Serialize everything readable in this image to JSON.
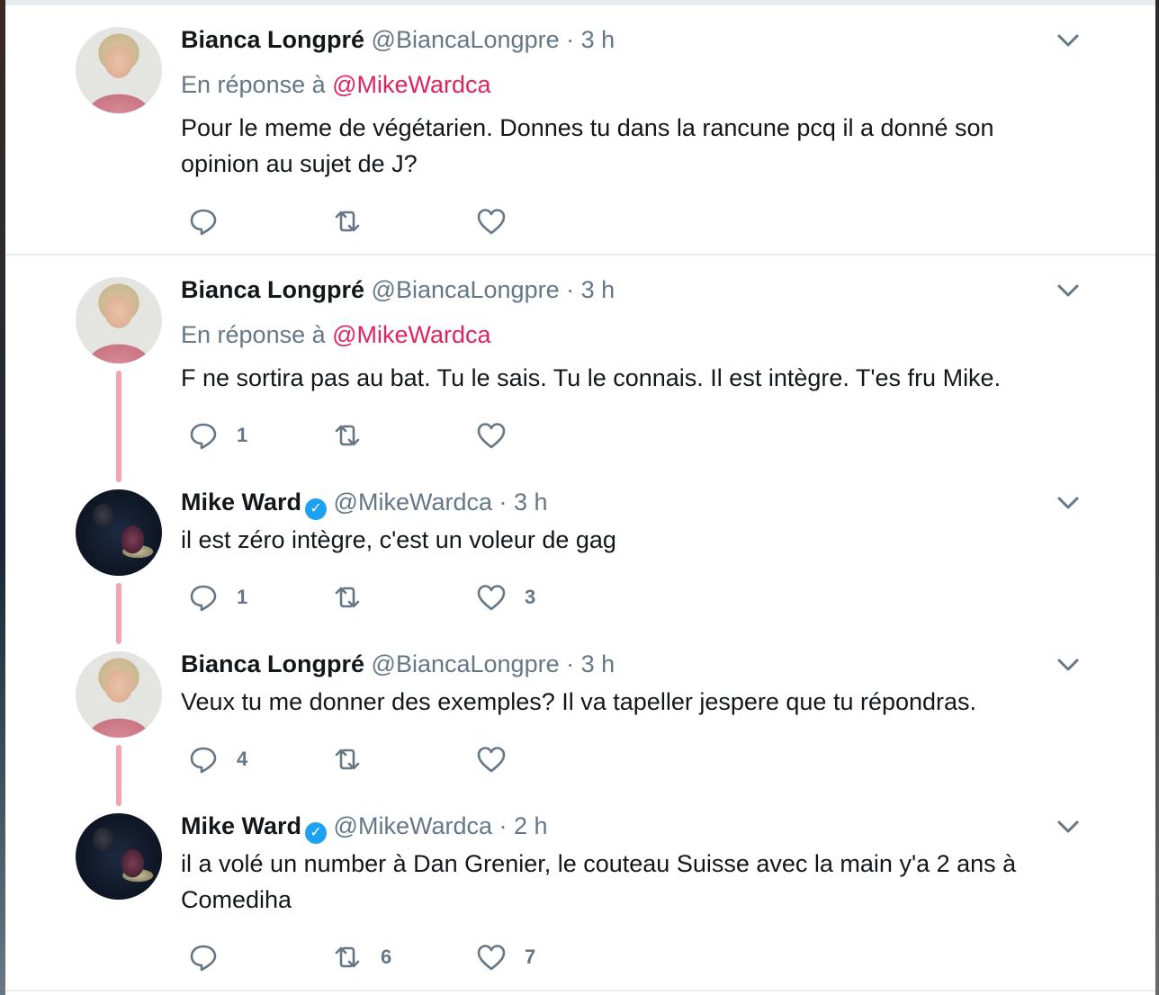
{
  "tweets": [
    {
      "author": "Bianca Longpré",
      "handle": "@BiancaLongpre",
      "separator": "·",
      "time": "3 h",
      "verified": false,
      "reply_prefix": "En réponse à",
      "reply_mention": "@MikeWardca",
      "text": "Pour le meme de végétarien. Donnes tu dans la rancune pcq il a donné son opinion au sujet de J?",
      "reply_count": "",
      "retweet_count": "",
      "like_count": ""
    },
    {
      "author": "Bianca Longpré",
      "handle": "@BiancaLongpre",
      "separator": "·",
      "time": "3 h",
      "verified": false,
      "reply_prefix": "En réponse à",
      "reply_mention": "@MikeWardca",
      "text": "F ne sortira pas au bat. Tu le sais. Tu le connais. Il est intègre. T'es fru Mike.",
      "reply_count": "1",
      "retweet_count": "",
      "like_count": ""
    },
    {
      "author": "Mike Ward",
      "handle": "@MikeWardca",
      "separator": "·",
      "time": "3 h",
      "verified": true,
      "text": "il est zéro intègre, c'est un voleur de gag",
      "reply_count": "1",
      "retweet_count": "",
      "like_count": "3"
    },
    {
      "author": "Bianca Longpré",
      "handle": "@BiancaLongpre",
      "separator": "·",
      "time": "3 h",
      "verified": false,
      "text": "Veux tu me donner des exemples? Il va tapeller jespere que tu répondras.",
      "reply_count": "4",
      "retweet_count": "",
      "like_count": ""
    },
    {
      "author": "Mike Ward",
      "handle": "@MikeWardca",
      "separator": "·",
      "time": "2 h",
      "verified": true,
      "text": "il a volé un number à Dan Grenier, le couteau Suisse avec la main y'a 2 ans à Comediha",
      "reply_count": "",
      "retweet_count": "6",
      "like_count": "7"
    }
  ],
  "icons": {
    "reply": "reply-icon",
    "retweet": "retweet-icon",
    "like": "heart-icon",
    "caret": "chevron-down-icon",
    "verified": "verified-badge-icon"
  },
  "colors": {
    "text": "#14171a",
    "muted": "#657786",
    "mention": "#e0245e",
    "verified": "#1da1f2",
    "thread_line": "#f4a5ad",
    "divider": "#e6ecf0"
  }
}
